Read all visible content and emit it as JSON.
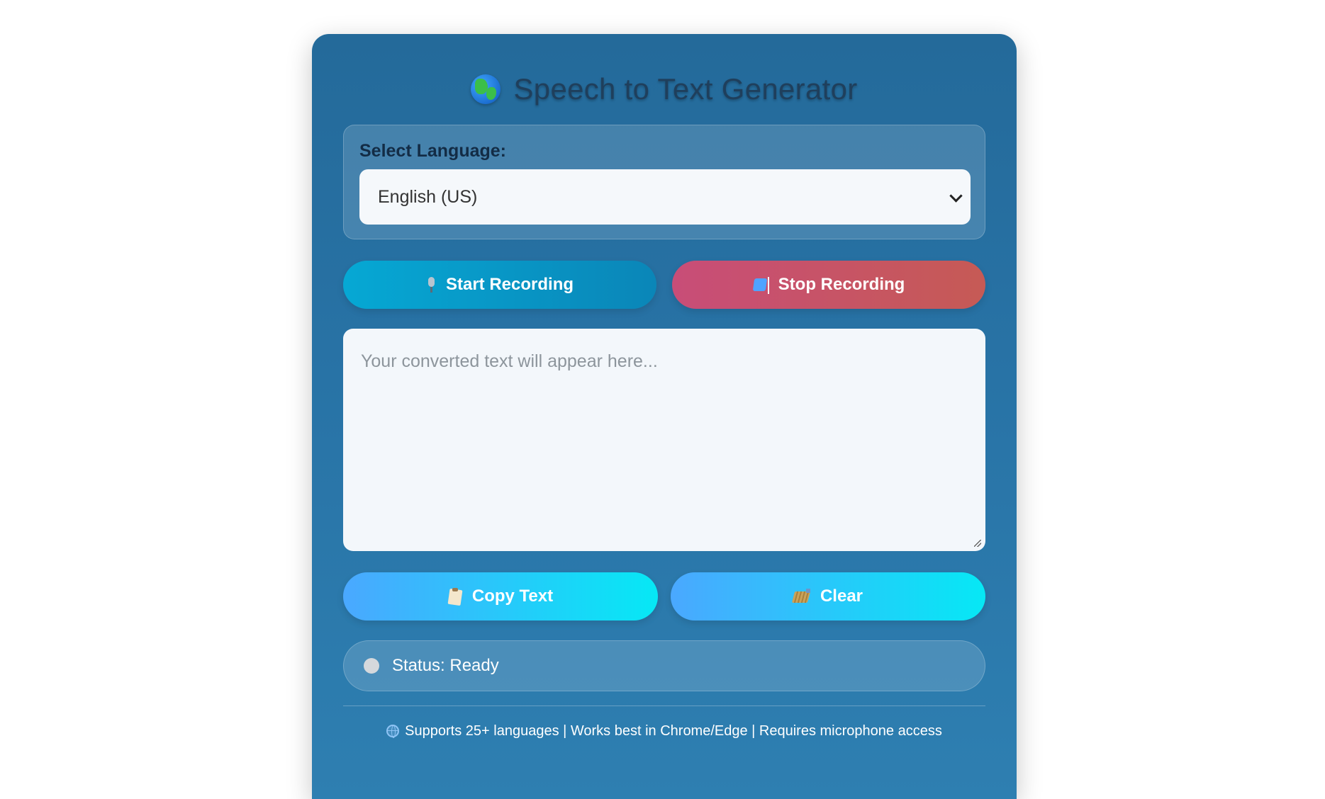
{
  "header": {
    "icon": "globe-icon",
    "title": "Speech to Text Generator"
  },
  "language": {
    "label": "Select Language:",
    "selected": "English (US)"
  },
  "controls": {
    "start_label": "Start Recording",
    "start_icon": "microphone-icon",
    "stop_label": "Stop Recording",
    "stop_icon": "stop-icon"
  },
  "output": {
    "value": "",
    "placeholder": "Your converted text will appear here..."
  },
  "actions": {
    "copy_label": "Copy Text",
    "copy_icon": "clipboard-icon",
    "clear_label": "Clear",
    "clear_icon": "broom-icon"
  },
  "status": {
    "text": "Status: Ready",
    "dot_color": "#d5d8dc"
  },
  "footer": {
    "icon": "globe-web-icon",
    "text": "Supports 25+ languages | Works best in Chrome/Edge | Requires microphone access"
  },
  "colors": {
    "card": "#2873a6",
    "start_button": "#06a8d4",
    "stop_button": "#c84d78",
    "action_button": "#4aa8ff"
  }
}
